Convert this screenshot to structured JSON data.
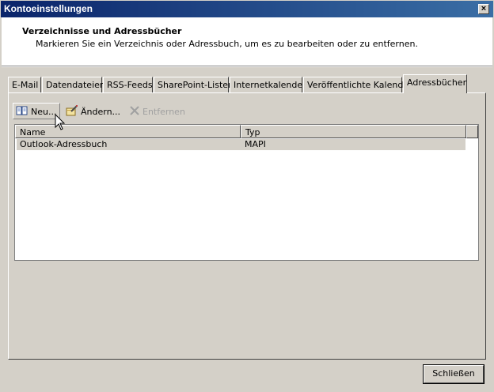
{
  "window": {
    "title": "Kontoeinstellungen",
    "close_glyph": "×"
  },
  "header": {
    "title": "Verzeichnisse und Adressbücher",
    "subtitle": "Markieren Sie ein Verzeichnis oder Adressbuch, um es zu bearbeiten oder zu entfernen."
  },
  "tabs": [
    {
      "label": "E-Mail"
    },
    {
      "label": "Datendateien"
    },
    {
      "label": "RSS-Feeds"
    },
    {
      "label": "SharePoint-Listen"
    },
    {
      "label": "Internetkalender"
    },
    {
      "label": "Veröffentlichte Kalender"
    },
    {
      "label": "Adressbücher",
      "active": true
    }
  ],
  "toolbar": {
    "new_label": "Neu...",
    "change_label": "Ändern...",
    "remove_label": "Entfernen"
  },
  "list": {
    "columns": [
      "Name",
      "Typ"
    ],
    "rows": [
      {
        "name": "Outlook-Adressbuch",
        "type": "MAPI"
      }
    ]
  },
  "footer": {
    "close_label": "Schließen"
  },
  "icons": {
    "new": "address-book-icon",
    "change": "edit-icon",
    "remove": "delete-x-icon",
    "cursor": "mouse-pointer-icon"
  }
}
